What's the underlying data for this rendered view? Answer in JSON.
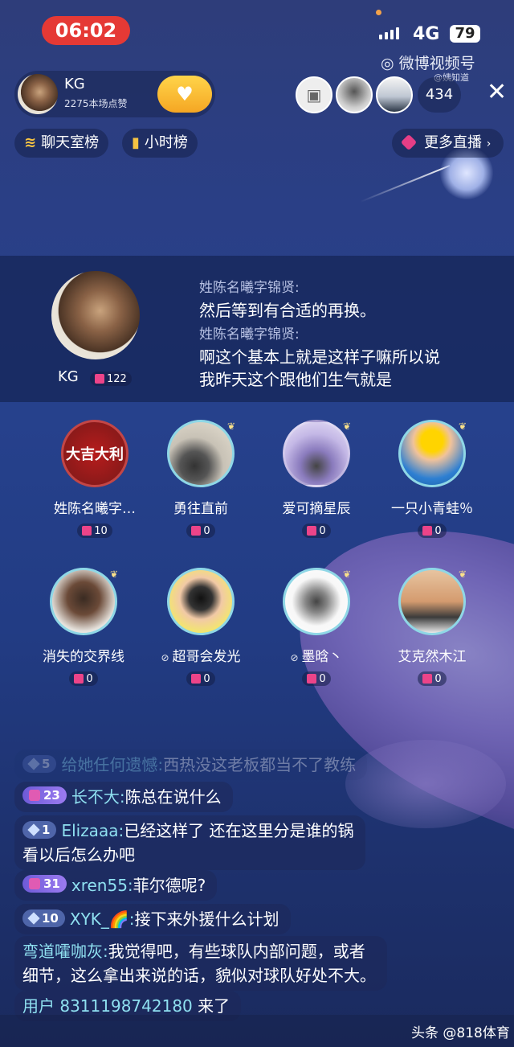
{
  "status": {
    "time": "06:02",
    "network": "4G",
    "battery": "79"
  },
  "watermark": {
    "brand": "微博视频号",
    "user": "@姨知道"
  },
  "host": {
    "name": "KG",
    "likes": "2275本场点赞"
  },
  "viewers": {
    "count": "434"
  },
  "chips": {
    "chatroom": "聊天室榜",
    "hourly": "小时榜",
    "more_live": "更多直播"
  },
  "panel": {
    "host_name": "KG",
    "host_badge": "122",
    "messages": [
      {
        "name": "姓陈名曦字锦贤:",
        "text": "然后等到有合适的再换。"
      },
      {
        "name": "姓陈名曦字锦贤:",
        "text": "啊这个基本上就是这样子嘛所以说"
      },
      {
        "text2": "我昨天这个跟他们生气就是"
      }
    ]
  },
  "seats": [
    {
      "name": "姓陈名曦字…",
      "badge": "10",
      "avatar_text": "大吉大利"
    },
    {
      "name": "勇往直前",
      "badge": "0"
    },
    {
      "name": "爱可摘星辰",
      "badge": "0"
    },
    {
      "name": "一只小青蛙％",
      "badge": "0"
    },
    {
      "name": "消失的交界线",
      "badge": "0"
    },
    {
      "name": "超哥会发光",
      "badge": "0"
    },
    {
      "name": "墨晗丶",
      "badge": "0"
    },
    {
      "name": "艾克然木江",
      "badge": "0"
    }
  ],
  "chat": [
    {
      "level": "5",
      "name": "给她任何遗憾:",
      "text": "西热没这老板都当不了教练"
    },
    {
      "level": "23",
      "name": "长不大:",
      "text": "陈总在说什么"
    },
    {
      "level": "1",
      "name": "Elizaaa:",
      "text": "已经这样了 还在这里分是谁的锅",
      "text2": "看以后怎么办吧"
    },
    {
      "level": "31",
      "name": "xren55:",
      "text": "菲尔德呢?"
    },
    {
      "level": "10",
      "name": "XYK_🌈:",
      "text": "接下来外援什么计划"
    },
    {
      "name": "弯道嚯咖灰:",
      "text": "我觉得吧，有些球队内部问题，或者",
      "text2": "细节，这么拿出来说的话，貌似对球队好处不大。"
    },
    {
      "name": "用户 8311198742180",
      "text": "来了"
    }
  ],
  "footer": {
    "source": "头条 @818体育"
  }
}
